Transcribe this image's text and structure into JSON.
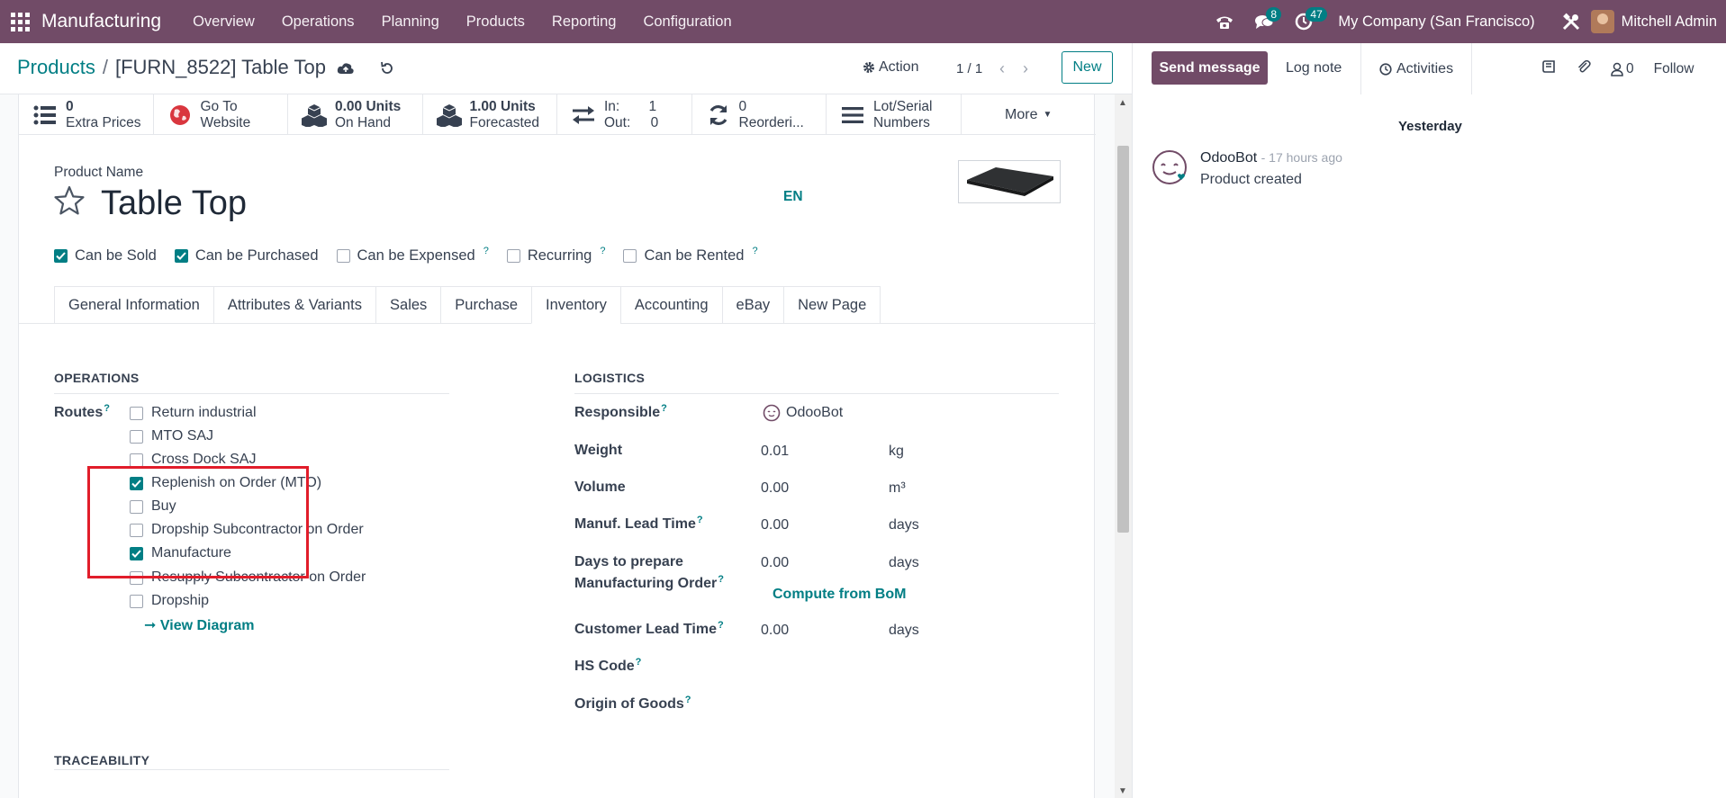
{
  "topbar": {
    "app_name": "Manufacturing",
    "menu": [
      "Overview",
      "Operations",
      "Planning",
      "Products",
      "Reporting",
      "Configuration"
    ],
    "messages_badge": "8",
    "activities_badge": "47",
    "company": "My Company (San Francisco)",
    "user": "Mitchell Admin"
  },
  "control": {
    "breadcrumb_parent": "Products",
    "breadcrumb_sep": "/",
    "breadcrumb_current": "[FURN_8522] Table Top",
    "action_label": "Action",
    "pager": "1 / 1",
    "new_label": "New"
  },
  "smart_buttons": [
    {
      "line1": "0",
      "line2": "Extra Prices"
    },
    {
      "line1": "Go To",
      "line2": "Website"
    },
    {
      "line1": "0.00 Units",
      "line2": "On Hand"
    },
    {
      "line1": "1.00 Units",
      "line2": "Forecasted"
    },
    {
      "line1": "In:",
      "v1": "1",
      "line2": "Out:",
      "v2": "0"
    },
    {
      "line1": "0",
      "line2": "Reorderi..."
    },
    {
      "line1": "Lot/Serial",
      "line2": "Numbers"
    }
  ],
  "more_label": "More",
  "product": {
    "name_label": "Product Name",
    "name": "Table Top",
    "lang": "EN"
  },
  "flags": [
    {
      "label": "Can be Sold",
      "checked": true,
      "tip": ""
    },
    {
      "label": "Can be Purchased",
      "checked": true,
      "tip": ""
    },
    {
      "label": "Can be Expensed",
      "checked": false,
      "tip": "?"
    },
    {
      "label": "Recurring",
      "checked": false,
      "tip": "?"
    },
    {
      "label": "Can be Rented",
      "checked": false,
      "tip": "?"
    }
  ],
  "tabs": [
    "General Information",
    "Attributes & Variants",
    "Sales",
    "Purchase",
    "Inventory",
    "Accounting",
    "eBay",
    "New Page"
  ],
  "active_tab": "Inventory",
  "operations": {
    "title": "OPERATIONS",
    "routes_label": "Routes",
    "routes_tip": "?",
    "routes": [
      {
        "label": "Return industrial",
        "checked": false
      },
      {
        "label": "MTO SAJ",
        "checked": false
      },
      {
        "label": "Cross Dock SAJ",
        "checked": false
      },
      {
        "label": "Replenish on Order (MTO)",
        "checked": true
      },
      {
        "label": "Buy",
        "checked": false
      },
      {
        "label": "Dropship Subcontractor on Order",
        "checked": false
      },
      {
        "label": "Manufacture",
        "checked": true
      },
      {
        "label": "Resupply Subcontractor on Order",
        "checked": false
      },
      {
        "label": "Dropship",
        "checked": false
      }
    ],
    "view_diagram": "View Diagram"
  },
  "logistics": {
    "title": "LOGISTICS",
    "responsible_label": "Responsible",
    "responsible_value": "OdooBot",
    "weight_label": "Weight",
    "weight_value": "0.01",
    "weight_unit": "kg",
    "volume_label": "Volume",
    "volume_value": "0.00",
    "volume_unit": "m³",
    "lead_label": "Manuf. Lead Time",
    "lead_value": "0.00",
    "lead_unit": "days",
    "prep_label_1": "Days to prepare",
    "prep_label_2": "Manufacturing Order",
    "prep_value": "0.00",
    "prep_unit": "days",
    "compute_label": "Compute from BoM",
    "cust_label": "Customer Lead Time",
    "cust_value": "0.00",
    "cust_unit": "days",
    "hs_label": "HS Code",
    "origin_label": "Origin of Goods",
    "tip": "?"
  },
  "traceability": {
    "title": "TRACEABILITY"
  },
  "chatter": {
    "send_message": "Send message",
    "log_note": "Log note",
    "activities": "Activities",
    "followers_count": "0",
    "follow": "Follow",
    "date_sep": "Yesterday",
    "author": "OdooBot",
    "ago": "- 17 hours ago",
    "body": "Product created"
  },
  "colors": {
    "brand": "#714b67",
    "accent": "#017e84",
    "highlight": "#e11d2a"
  }
}
